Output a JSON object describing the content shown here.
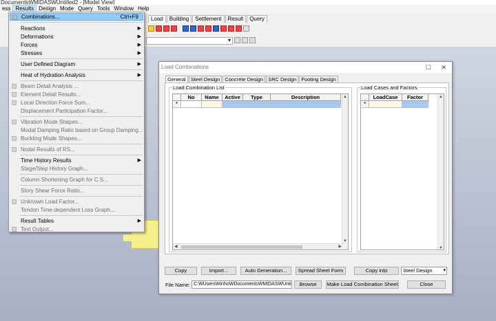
{
  "window": {
    "title": "DocumentsWMIDASWUntitled2 - [Model View]"
  },
  "menubar": [
    {
      "id": "analysis",
      "label": "ess"
    },
    {
      "id": "results",
      "label": "Results"
    },
    {
      "id": "design",
      "label": "Design"
    },
    {
      "id": "mode",
      "label": "Mode"
    },
    {
      "id": "query",
      "label": "Query"
    },
    {
      "id": "tools",
      "label": "Tools"
    },
    {
      "id": "window",
      "label": "Window"
    },
    {
      "id": "help",
      "label": "Help"
    }
  ],
  "ribbon": {
    "tabs": [
      "Load",
      "Building",
      "Settlement",
      "Result",
      "Query"
    ]
  },
  "results_menu": {
    "combinations": {
      "label": "Combinations...",
      "shortcut": "Ctrl+F9"
    },
    "items": [
      {
        "label": "Reactions",
        "submenu": true
      },
      {
        "label": "Deformations",
        "submenu": true
      },
      {
        "label": "Forces",
        "submenu": true
      },
      {
        "label": "Stresses",
        "submenu": true
      },
      {
        "label": "User Defined Diagram",
        "submenu": true
      },
      {
        "label": "Heat of Hydration Analysis",
        "submenu": true
      },
      {
        "label": "Beam Detail Analysis ...",
        "disabled": true
      },
      {
        "label": "Element Detail Results...",
        "disabled": true
      },
      {
        "label": "Local Direction Force Sum...",
        "disabled": true
      },
      {
        "label": "Displacement Participation Factor...",
        "disabled": true
      },
      {
        "label": "Vibration Mode Shapes...",
        "disabled": true
      },
      {
        "label": "Modal Damping Ratio based on Group Damping...",
        "disabled": true
      },
      {
        "label": "Buckling Mode Shapes...",
        "disabled": true
      },
      {
        "label": "Nodal Results of RS...",
        "disabled": true
      },
      {
        "label": "Time History Results",
        "submenu": true
      },
      {
        "label": "Stage/Step History Graph...",
        "disabled": true
      },
      {
        "label": "Column Shortening Graph for C.S...",
        "disabled": true
      },
      {
        "label": "Story Shear Force Ratio...",
        "disabled": true
      },
      {
        "label": "Unknown Load Factor...",
        "disabled": true
      },
      {
        "label": "Tendon Time-dependent Loss Graph...",
        "disabled": true
      },
      {
        "label": "Result Tables",
        "submenu": true
      },
      {
        "label": "Text Output...",
        "disabled": true
      }
    ]
  },
  "dialog": {
    "title": "Load Combinations",
    "maximize": "☐",
    "close": "✕",
    "tabs": [
      "General",
      "Steel Design",
      "Concrete Design",
      "SRC Design",
      "Footing Design"
    ],
    "left_group": {
      "label": "Load Combination List",
      "columns": [
        "No",
        "Name",
        "Active",
        "Type",
        "Description"
      ],
      "new_row_marker": "*"
    },
    "right_group": {
      "label": "Load Cases and Factors",
      "columns": [
        "LoadCase",
        "Factor"
      ],
      "new_row_marker": "*"
    },
    "buttons": {
      "copy": "Copy",
      "import": "Import...",
      "auto_generation": "Auto Generation...",
      "spread_sheet": "Spread Sheet Form",
      "copy_into": "Copy into",
      "browse": "Browse",
      "make_sheet": "Make Load Combination Sheet",
      "close": "Close"
    },
    "copy_into_select": "Steel Design",
    "file_name_label": "File Name:",
    "file_name_value": "C:WUsersWinhoWDocumentsWMIDASWUntitled"
  }
}
